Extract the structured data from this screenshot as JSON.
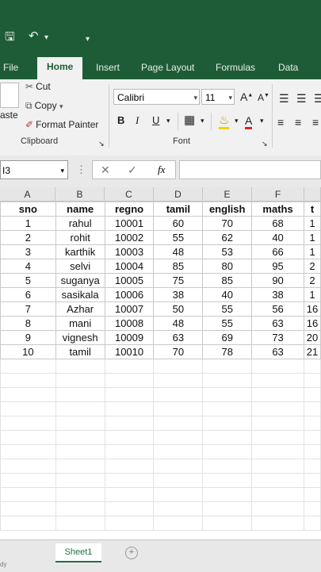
{
  "quick_access": {
    "save_icon": "save-icon",
    "undo_icon": "undo-icon"
  },
  "tabs": [
    "File",
    "Home",
    "Insert",
    "Page Layout",
    "Formulas",
    "Data"
  ],
  "clipboard": {
    "paste_label": "aste",
    "cut": "Cut",
    "copy": "Copy",
    "format_painter": "Format Painter",
    "group_label": "Clipboard"
  },
  "font": {
    "name": "Calibri",
    "size": "11",
    "group_label": "Font",
    "grow": "A",
    "shrink": "A",
    "bold": "B",
    "italic": "I",
    "underline": "U",
    "font_color": "A"
  },
  "formula_bar": {
    "name_box": "I3",
    "fx": "fx",
    "value": ""
  },
  "columns": [
    "A",
    "B",
    "C",
    "D",
    "E",
    "F"
  ],
  "table": {
    "headers": [
      "sno",
      "name",
      "regno",
      "tamil",
      "english",
      "maths",
      "t"
    ],
    "rows": [
      [
        "1",
        "rahul",
        "10001",
        "60",
        "70",
        "68",
        "1"
      ],
      [
        "2",
        "rohit",
        "10002",
        "55",
        "62",
        "40",
        "1"
      ],
      [
        "3",
        "karthik",
        "10003",
        "48",
        "53",
        "66",
        "1"
      ],
      [
        "4",
        "selvi",
        "10004",
        "85",
        "80",
        "95",
        "2"
      ],
      [
        "5",
        "suganya",
        "10005",
        "75",
        "85",
        "90",
        "2"
      ],
      [
        "6",
        "sasikala",
        "10006",
        "38",
        "40",
        "38",
        "1"
      ],
      [
        "7",
        "Azhar",
        "10007",
        "50",
        "55",
        "56",
        "16"
      ],
      [
        "8",
        "mani",
        "10008",
        "48",
        "55",
        "63",
        "16"
      ],
      [
        "9",
        "vignesh",
        "10009",
        "63",
        "69",
        "73",
        "20"
      ],
      [
        "10",
        "tamil",
        "10010",
        "70",
        "78",
        "63",
        "21"
      ]
    ]
  },
  "status": {
    "ready": "dy"
  },
  "sheet_tabs": [
    "Sheet1"
  ],
  "colors": {
    "excel_green": "#1e5c37",
    "ribbon_bg": "#f1f1f1"
  }
}
